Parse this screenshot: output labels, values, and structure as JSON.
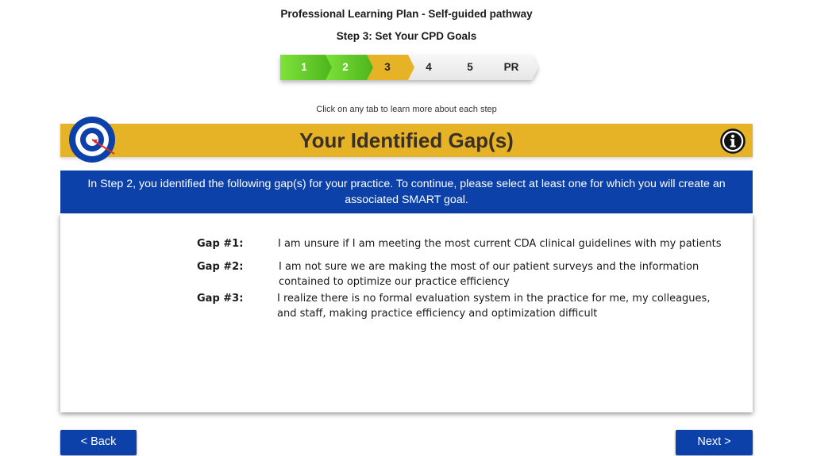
{
  "header": {
    "title": "Professional Learning Plan - Self-guided pathway",
    "subtitle": "Step 3: Set Your CPD Goals"
  },
  "stepper": {
    "steps": [
      {
        "label": "1",
        "state": "complete",
        "color": "#5ec828"
      },
      {
        "label": "2",
        "state": "complete",
        "color": "#5ec828"
      },
      {
        "label": "3",
        "state": "current",
        "color": "#e7b326"
      },
      {
        "label": "4",
        "state": "upcoming",
        "color": "#ededed"
      },
      {
        "label": "5",
        "state": "upcoming",
        "color": "#ededed"
      },
      {
        "label": "PR",
        "state": "upcoming",
        "color": "#ededed"
      }
    ],
    "hint": "Click on any tab to learn more about each step"
  },
  "banner": {
    "title": "Your Identified Gap(s)",
    "icon": "target-icon",
    "info_icon": "info-icon"
  },
  "intro": "In Step 2, you identified the following gap(s) for your practice. To continue, please select at least one for which you will create an associated SMART goal.",
  "gaps": [
    {
      "label": "Gap #1:",
      "text": "I am unsure if I am meeting the most current CDA clinical guidelines with my patients"
    },
    {
      "label": "Gap #2:",
      "text": "I am not sure we are making the most of our patient surveys and the information contained to optimize our practice efficiency"
    },
    {
      "label": "Gap #3:",
      "text": "I realize there is no formal evaluation system in the practice for me, my colleagues, and staff, making practice efficiency and optimization difficult"
    }
  ],
  "nav": {
    "back_label": "< Back",
    "next_label": "Next >"
  },
  "colors": {
    "accent_blue": "#0b41a8",
    "accent_gold": "#e7b326",
    "complete_green": "#5ec828"
  }
}
